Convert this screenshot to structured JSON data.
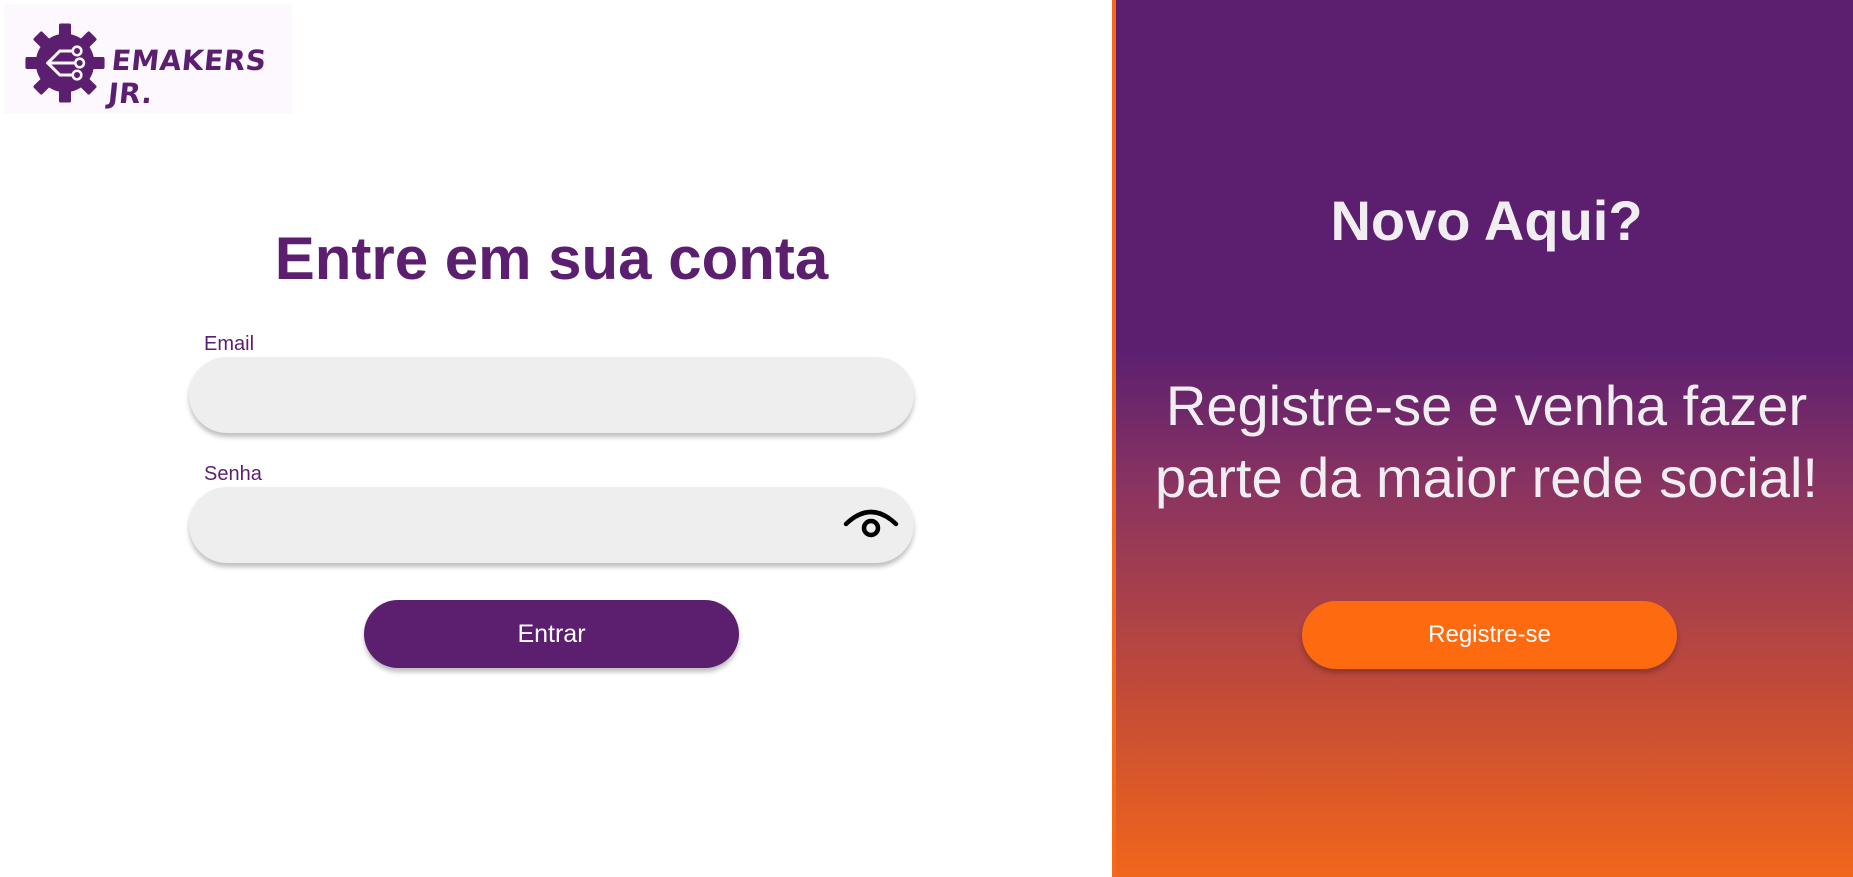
{
  "brand": {
    "name": "EMAKERS JR.",
    "logo_icon": "gear-circuit-icon",
    "color": "#5c1f70"
  },
  "login": {
    "title": "Entre em sua conta",
    "email_label": "Email",
    "email_value": "",
    "password_label": "Senha",
    "password_value": "",
    "password_toggle_icon": "eye-icon",
    "submit_label": "Entrar"
  },
  "register_panel": {
    "heading": "Novo Aqui?",
    "message": "Registre-se e venha fazer parte da maior rede social!",
    "button_label": "Registre-se",
    "accent_color": "#fd6a10"
  }
}
